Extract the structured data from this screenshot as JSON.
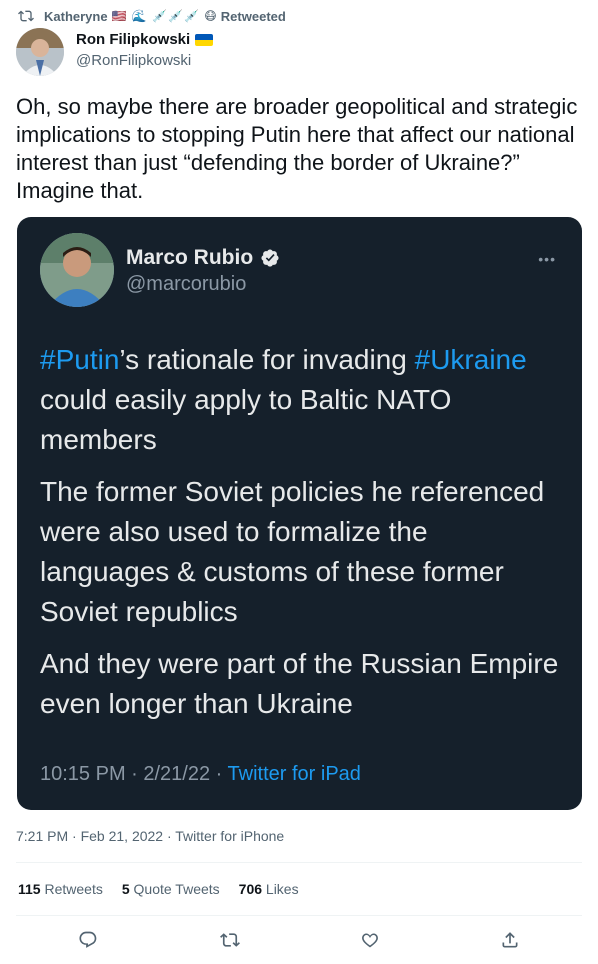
{
  "retweet": {
    "icon": "retweet-icon",
    "user": "Katheryne",
    "emoji": "🇺🇸 🌊 💉💉💉 😷",
    "label": "Retweeted"
  },
  "author": {
    "name": "Ron Filipkowski",
    "flag": "ukraine-flag",
    "handle": "@RonFilipkowski"
  },
  "tweet_text": "Oh, so maybe there are broader geopolitical and strategic implications to stopping Putin here that affect our national interest than just “defending the border of Ukraine?” Imagine that.",
  "embedded": {
    "name": "Marco Rubio",
    "verified_icon": "verified-badge-icon",
    "handle": "@marcorubio",
    "more_icon": "more-options-icon",
    "p1": {
      "tag1": "#Putin",
      "t1": "’s rationale for invading ",
      "tag2": "#Ukraine",
      "t2": " could easily apply to Baltic NATO members"
    },
    "p2": "The former Soviet policies he referenced were also used to formalize the languages & customs of these former Soviet republics",
    "p3": "And they were part of the Russian Empire even longer than Ukraine",
    "time": "10:15 PM · 2/21/22 · ",
    "source": "Twitter for iPad"
  },
  "meta": "7:21 PM · Feb 21, 2022 · Twitter for iPhone",
  "stats": {
    "retweets_count": "115",
    "retweets_label": " Retweets",
    "quotes_count": "5",
    "quotes_label": " Quote Tweets",
    "likes_count": "706",
    "likes_label": " Likes"
  },
  "actions": [
    "reply-icon",
    "retweet-icon",
    "like-icon",
    "share-icon"
  ],
  "colors": {
    "link": "#1d9bf0",
    "embed_bg": "#15202b",
    "muted": "#536471"
  }
}
